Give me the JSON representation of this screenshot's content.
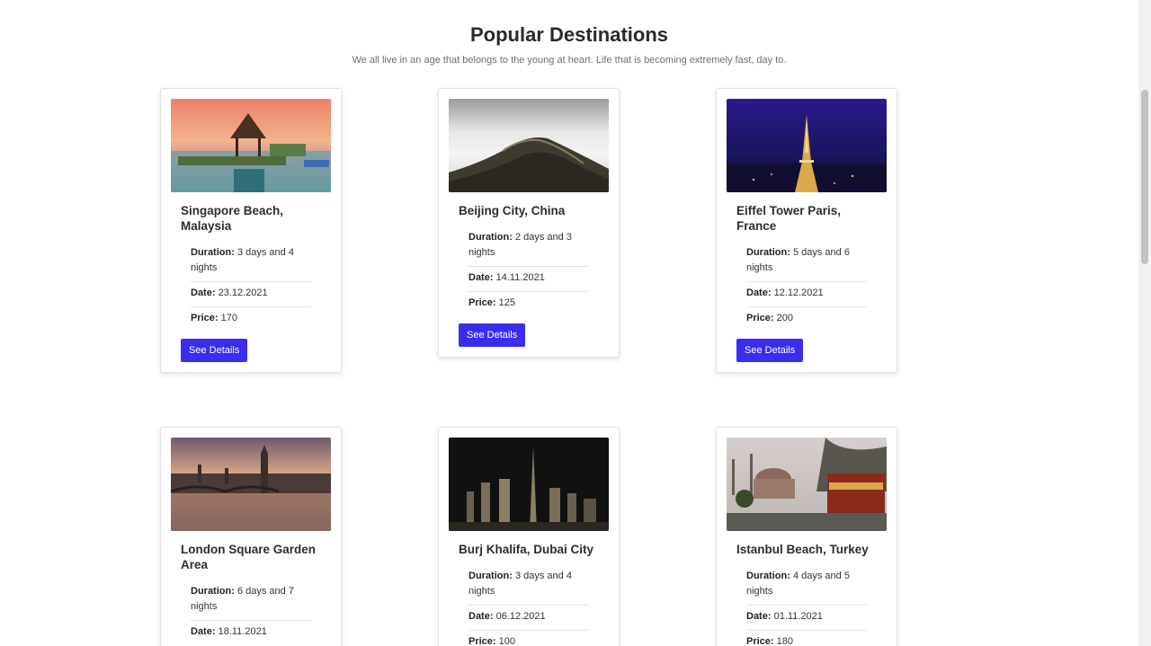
{
  "section": {
    "title": "Popular Destinations",
    "subtitle": "We all live in an age that belongs to the young at heart. Life that is becoming extremely fast, day to."
  },
  "labels": {
    "duration": "Duration:",
    "date": "Date:",
    "price": "Price:"
  },
  "cards": [
    {
      "title": "Singapore Beach, Malaysia",
      "duration": "3 days and 4 nights",
      "date": "23.12.2021",
      "price": "170",
      "button": "See Details",
      "image": "tropical-gazebo-image"
    },
    {
      "title": "Beijing City, China",
      "duration": "2 days and 3 nights",
      "date": "14.11.2021",
      "price": "125",
      "button": "See Details",
      "image": "great-wall-image"
    },
    {
      "title": "Eiffel Tower Paris, France",
      "duration": "5 days and 6 nights",
      "date": "12.12.2021",
      "price": "200",
      "button": "See Details",
      "image": "eiffel-tower-night-image"
    },
    {
      "title": "London Square Garden Area",
      "duration": "6 days and 7 nights",
      "date": "18.11.2021",
      "price": "",
      "button": "",
      "image": "london-skyline-image"
    },
    {
      "title": "Burj Khalifa, Dubai City",
      "duration": "3 days and 4 nights",
      "date": "06.12.2021",
      "price": "100",
      "button": "",
      "image": "dubai-skyline-night-image"
    },
    {
      "title": "Istanbul Beach, Turkey",
      "duration": "4 days and 5 nights",
      "date": "01.11.2021",
      "price": "180",
      "button": "",
      "image": "istanbul-mosque-image"
    }
  ],
  "colors": {
    "button": "#3b2df0",
    "heading": "#2a2a2a",
    "subtitle": "#6f6f6f"
  }
}
